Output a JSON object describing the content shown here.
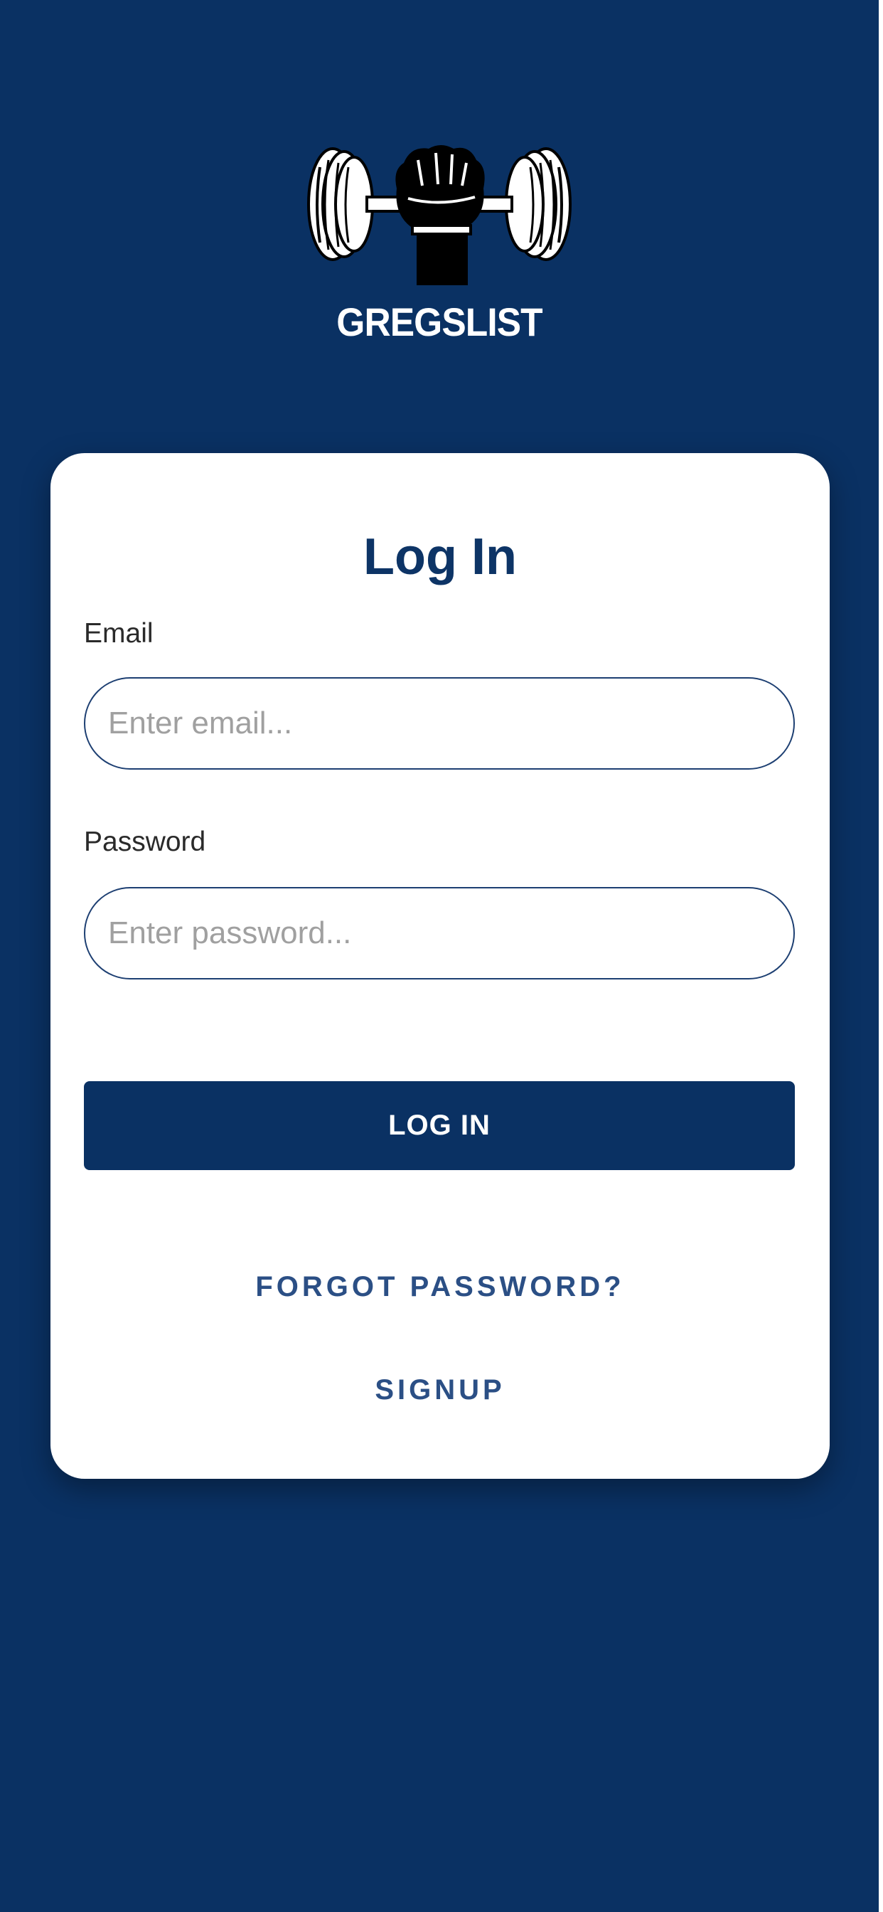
{
  "brand": {
    "name": "GREGSLIST",
    "logo_icon": "fist-dumbbell-icon"
  },
  "login_card": {
    "title": "Log In",
    "email": {
      "label": "Email",
      "value": "",
      "placeholder": "Enter email..."
    },
    "password": {
      "label": "Password",
      "value": "",
      "placeholder": "Enter password..."
    },
    "submit_label": "LOG IN",
    "forgot_password_label": "FORGOT PASSWORD?",
    "signup_label": "SIGNUP"
  },
  "colors": {
    "background": "#0a3163",
    "card": "#ffffff",
    "primary": "#0a3163",
    "title": "#0d3466",
    "link": "#2b4f85",
    "input_border": "#1d3f72"
  }
}
